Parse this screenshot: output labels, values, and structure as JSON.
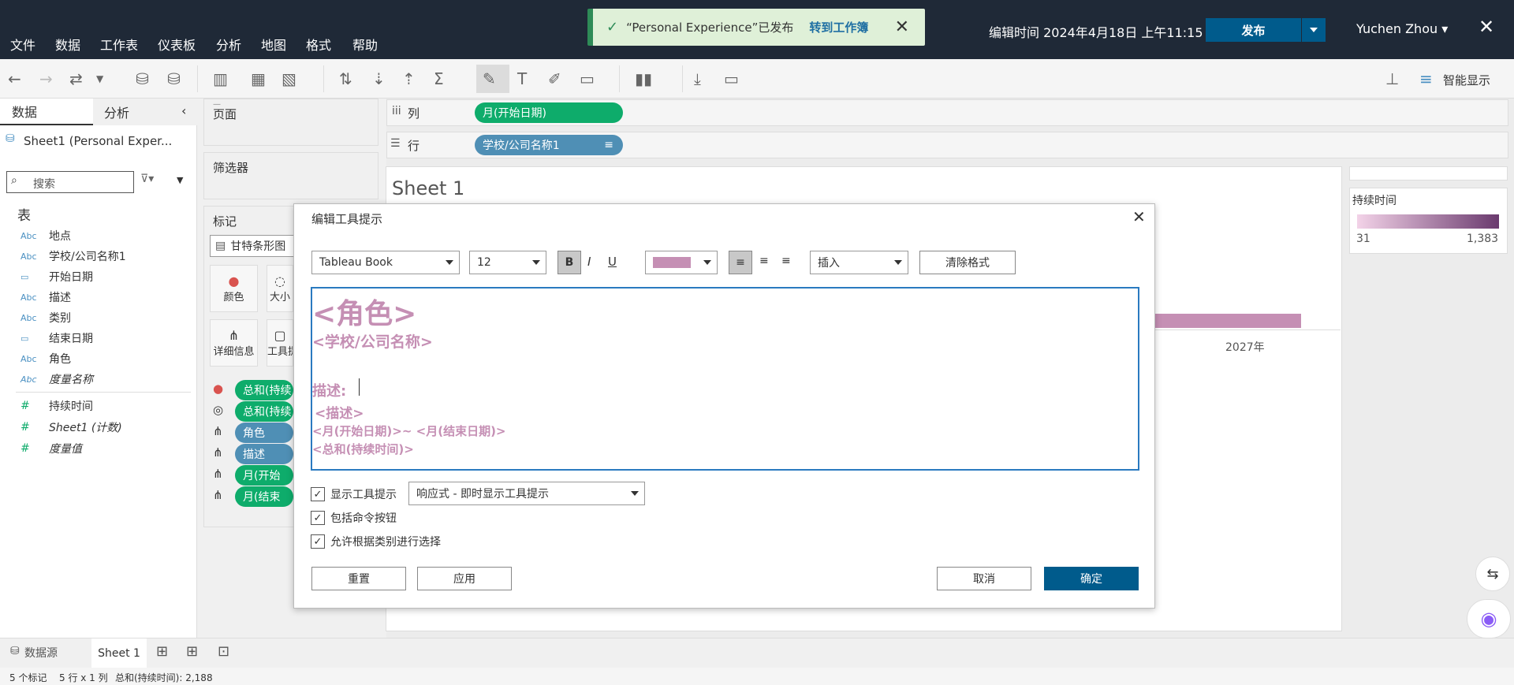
{
  "menu": [
    "文件",
    "数据",
    "工作表",
    "仪表板",
    "分析",
    "地图",
    "格式",
    "帮助"
  ],
  "toast": {
    "message": "“Personal Experience”已发布",
    "link": "转到工作簿"
  },
  "header": {
    "edit_time": "编辑时间 2024年4月18日 上午11:15",
    "publish": "发布",
    "user": "Yuchen Zhou"
  },
  "toolbar": {
    "smart_show": "智能显示"
  },
  "left": {
    "tab_data": "数据",
    "tab_analysis": "分析",
    "datasource": "Sheet1 (Personal Exper...",
    "search_placeholder": "搜索",
    "table_header": "表",
    "fields": [
      {
        "type": "Abc",
        "name": "地点"
      },
      {
        "type": "Abc",
        "name": "学校/公司名称1"
      },
      {
        "type": "date",
        "name": "开始日期"
      },
      {
        "type": "Abc",
        "name": "描述"
      },
      {
        "type": "Abc",
        "name": "类别"
      },
      {
        "type": "date",
        "name": "结束日期"
      },
      {
        "type": "Abc",
        "name": "角色"
      },
      {
        "type": "Abc",
        "name": "度量名称"
      }
    ],
    "measures": [
      {
        "type": "#",
        "name": "持续时间"
      },
      {
        "type": "#",
        "name": "Sheet1 (计数)"
      },
      {
        "type": "#",
        "name": "度量值"
      }
    ]
  },
  "shelves": {
    "pages": "页面",
    "filters": "筛选器",
    "marks": "标记",
    "mark_type": "甘特条形图",
    "mark_buttons": [
      "颜色",
      "大小",
      "详细信息",
      "工具提示"
    ],
    "mark_pills": [
      "总和(持续",
      "总和(持续",
      "角色",
      "描述",
      "月(开始",
      "月(结束"
    ],
    "columns_label": "列",
    "rows_label": "行",
    "columns_pill": "月(开始日期)",
    "rows_pill": "学校/公司名称1"
  },
  "view": {
    "sheet_title": "Sheet 1",
    "axis_label": "2027年"
  },
  "legend": {
    "title": "持续时间",
    "min": "31",
    "max": "1,383"
  },
  "dialog": {
    "title": "编辑工具提示",
    "font": "Tableau Book",
    "size": "12",
    "insert": "插入",
    "clear": "清除格式",
    "lines": {
      "l1": "<角色>",
      "l2": "<学校/公司名称>",
      "l3": "描述:",
      "l4": "<描述>",
      "l5": "<月(开始日期)>~ <月(结束日期)>",
      "l6": "<总和(持续时间)>"
    },
    "show_tooltip": "显示工具提示",
    "tooltip_mode": "响应式 - 即时显示工具提示",
    "include_cmd": "包括命令按钮",
    "allow_select": "允许根据类别进行选择",
    "reset": "重置",
    "apply": "应用",
    "cancel": "取消",
    "ok": "确定",
    "text_color": "#c58fb4"
  },
  "tabs": {
    "datasource": "数据源",
    "sheet": "Sheet 1"
  },
  "status": {
    "marks": "5 个标记",
    "rows": "5 行 x 1 列",
    "sum": "总和(持续时间): 2,188"
  }
}
